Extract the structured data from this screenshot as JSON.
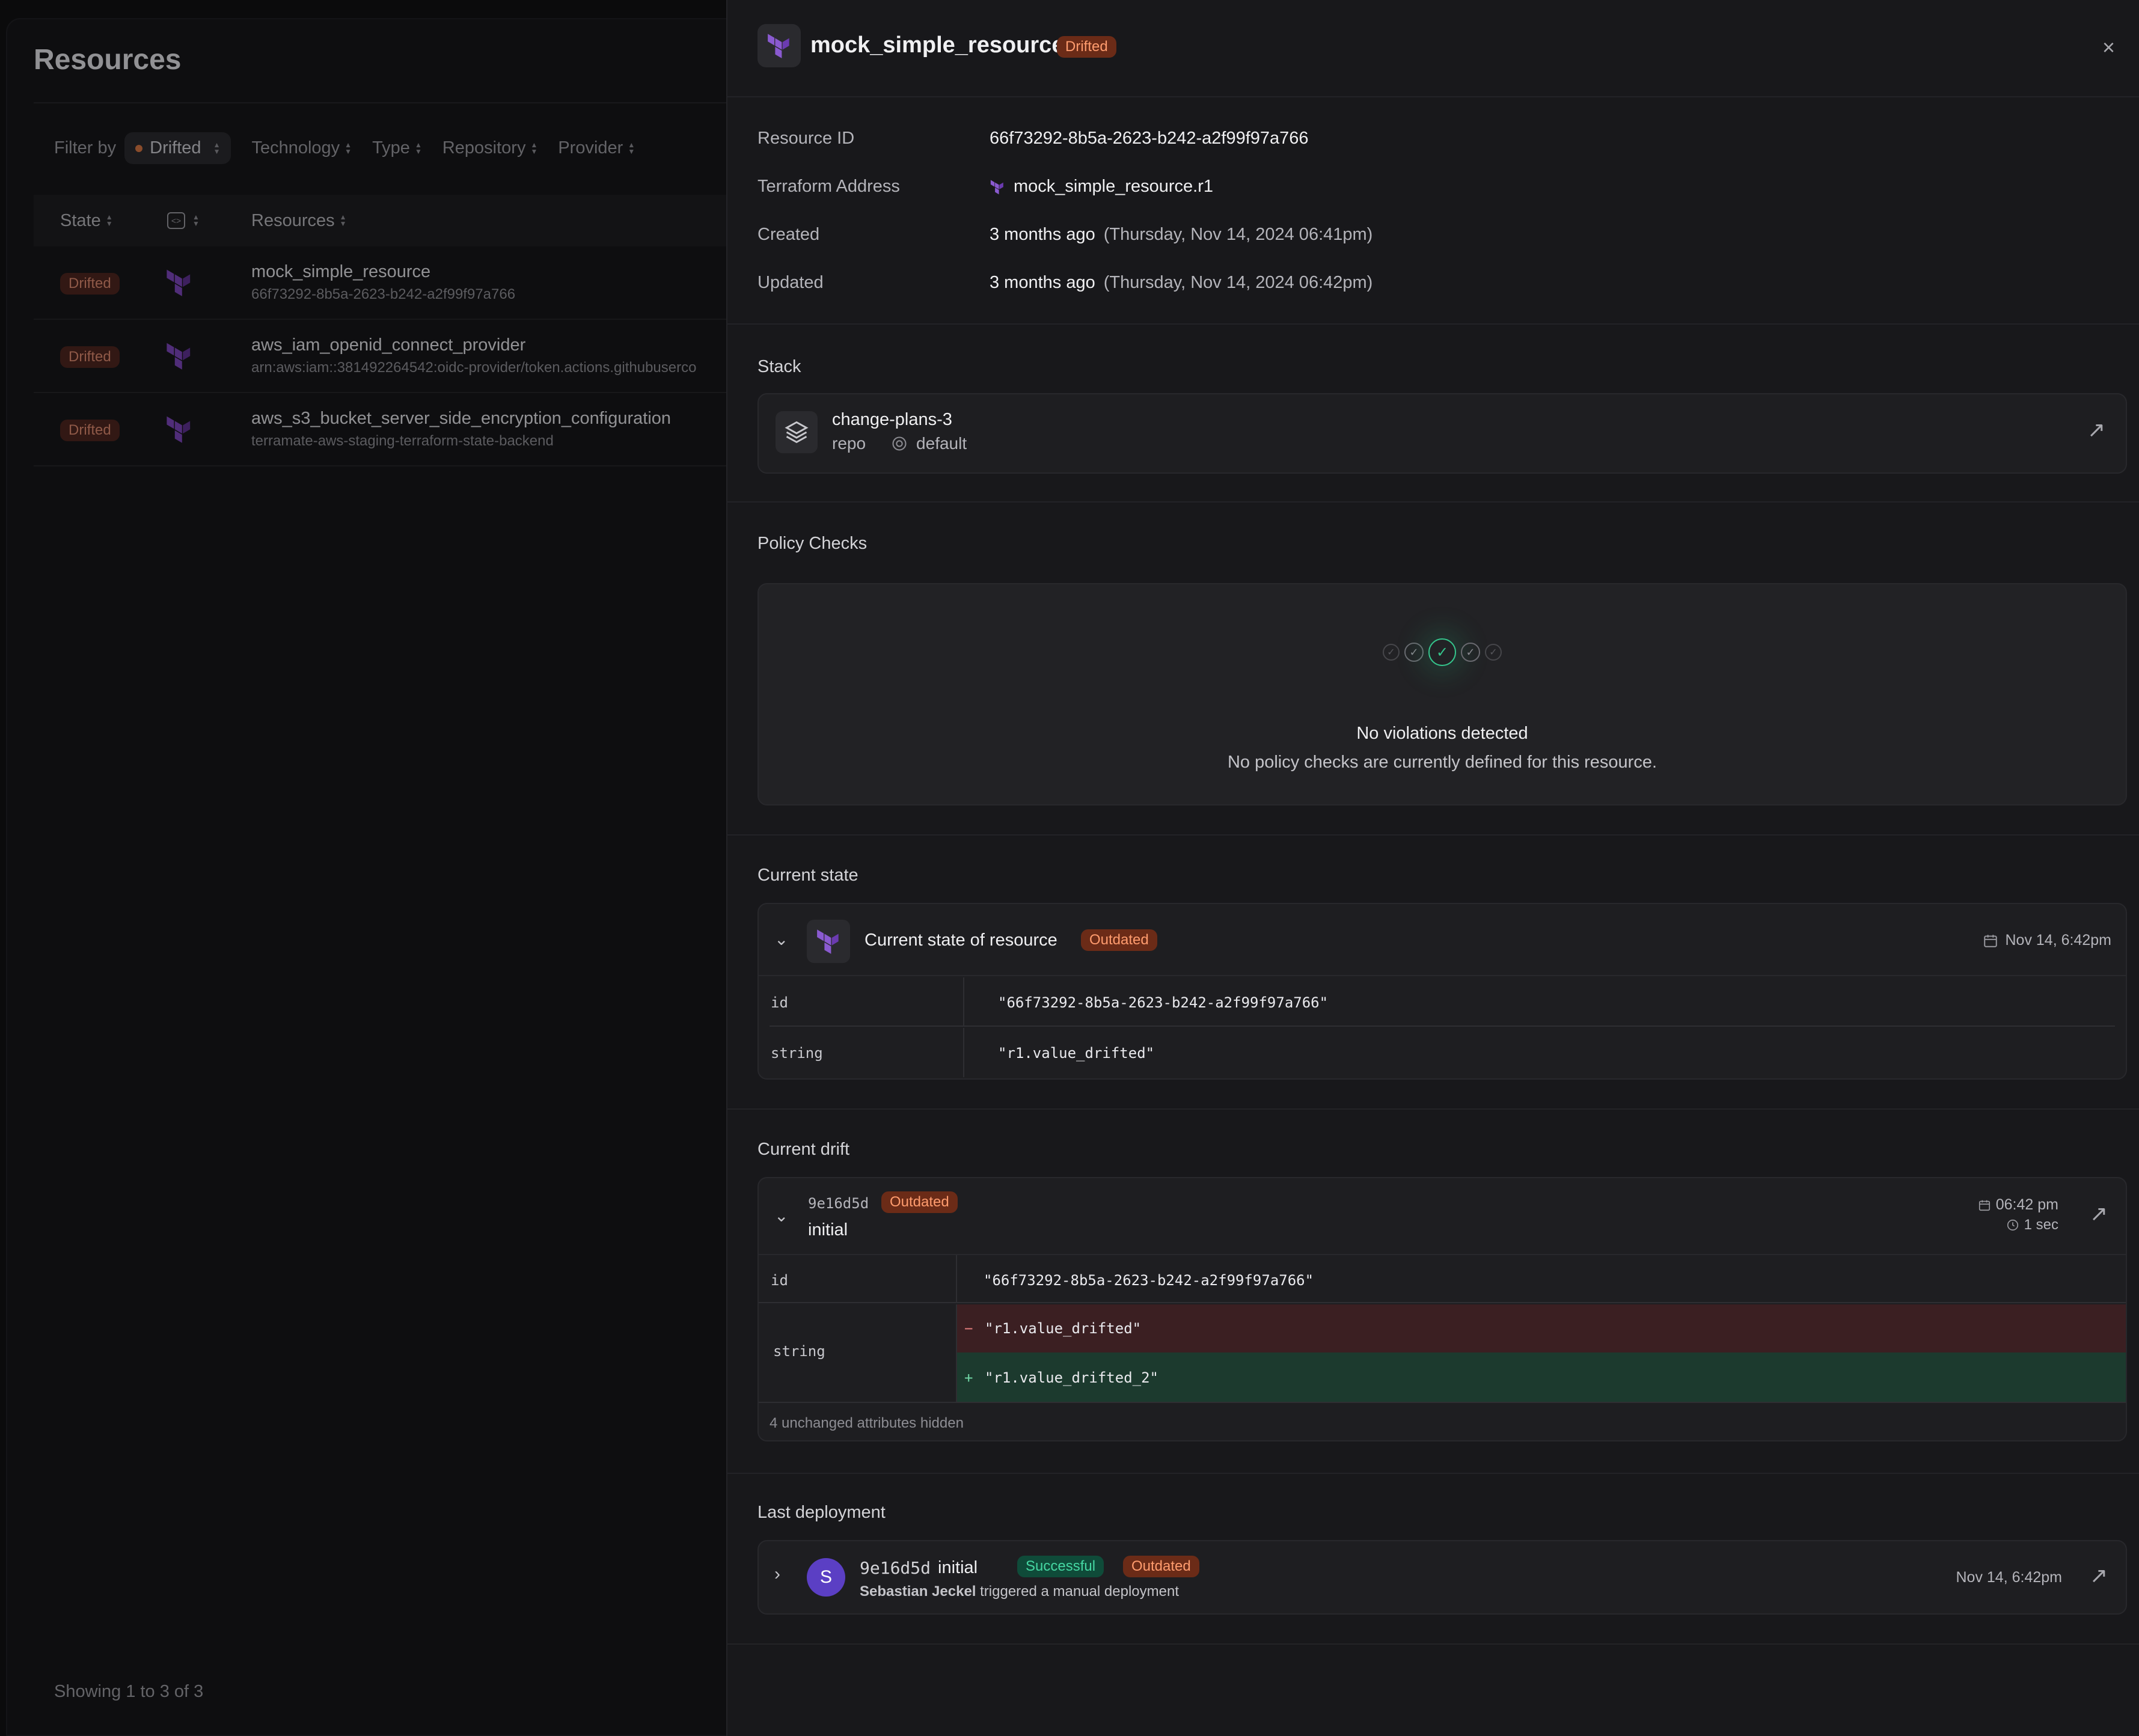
{
  "left": {
    "title": "Resources",
    "filter": {
      "label": "Filter by",
      "active_chip": "Drifted",
      "options": [
        "Technology",
        "Type",
        "Repository",
        "Provider"
      ]
    },
    "table": {
      "headers": {
        "state": "State",
        "resources": "Resources"
      },
      "rows": [
        {
          "state": "Drifted",
          "name": "mock_simple_resource",
          "id": "66f73292-8b5a-2623-b242-a2f99f97a766"
        },
        {
          "state": "Drifted",
          "name": "aws_iam_openid_connect_provider",
          "id": "arn:aws:iam::381492264542:oidc-provider/token.actions.githubuserco"
        },
        {
          "state": "Drifted",
          "name": "aws_s3_bucket_server_side_encryption_configuration",
          "id": "terramate-aws-staging-terraform-state-backend"
        }
      ]
    },
    "footer": "Showing 1 to 3 of 3"
  },
  "panel": {
    "title": "mock_simple_resource",
    "badge": "Drifted",
    "close": "×",
    "meta": {
      "resource_id_label": "Resource ID",
      "resource_id": "66f73292-8b5a-2623-b242-a2f99f97a766",
      "address_label": "Terraform Address",
      "address": "mock_simple_resource.r1",
      "created_label": "Created",
      "created_rel": "3 months ago",
      "created_abs": "(Thursday, Nov 14, 2024 06:41pm)",
      "updated_label": "Updated",
      "updated_rel": "3 months ago",
      "updated_abs": "(Thursday, Nov 14, 2024 06:42pm)"
    },
    "stack": {
      "section": "Stack",
      "name": "change-plans-3",
      "repo": "repo",
      "branch": "default"
    },
    "policy": {
      "section": "Policy Checks",
      "title": "No violations detected",
      "subtitle": "No policy checks are currently defined for this resource."
    },
    "current_state": {
      "section": "Current state",
      "title": "Current state of resource",
      "badge": "Outdated",
      "date": "Nov 14, 6:42pm",
      "rows": [
        {
          "key": "id",
          "value": "\"66f73292-8b5a-2623-b242-a2f99f97a766\""
        },
        {
          "key": "string",
          "value": "\"r1.value_drifted\""
        }
      ]
    },
    "current_drift": {
      "section": "Current drift",
      "commit": "9e16d5d",
      "badge": "Outdated",
      "title": "initial",
      "time": "06:42 pm",
      "duration": "1 sec",
      "id_key": "id",
      "id_value": "\"66f73292-8b5a-2623-b242-a2f99f97a766\"",
      "string_key": "string",
      "removed": "\"r1.value_drifted\"",
      "added": "\"r1.value_drifted_2\"",
      "removed_sign": "−",
      "added_sign": "+",
      "hidden_note": "4 unchanged attributes hidden"
    },
    "last_deployment": {
      "section": "Last deployment",
      "avatar": "S",
      "commit": "9e16d5d",
      "title": "initial",
      "badge_success": "Successful",
      "badge_outdated": "Outdated",
      "user": "Sebastian Jeckel",
      "action": "triggered a manual deployment",
      "date": "Nov 14, 6:42pm"
    }
  },
  "colors": {
    "terraform_purple": "#7b42bc",
    "outdated_bg": "#6b2b17",
    "success_bg": "#0f4b39",
    "removed_bg": "#3b1f22",
    "added_bg": "#1c3a2e"
  }
}
